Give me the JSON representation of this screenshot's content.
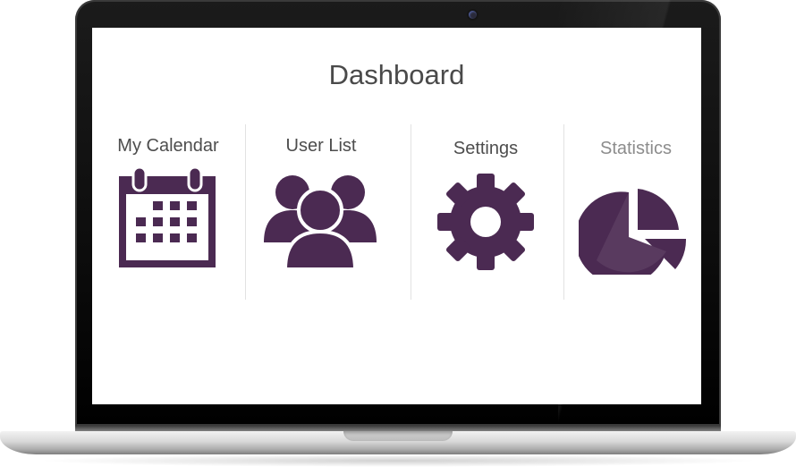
{
  "dashboard": {
    "title": "Dashboard",
    "tiles": [
      {
        "label": "My Calendar",
        "icon": "calendar-icon"
      },
      {
        "label": "User List",
        "icon": "users-icon"
      },
      {
        "label": "Settings",
        "icon": "gear-icon"
      },
      {
        "label": "Statistics",
        "icon": "pie-chart-icon"
      }
    ]
  },
  "colors": {
    "icon": "#4b2a52",
    "title": "#4a4a4a",
    "label": "#4d4d4d",
    "muted_label": "#8c8c8c",
    "divider": "#e2e2e2"
  }
}
